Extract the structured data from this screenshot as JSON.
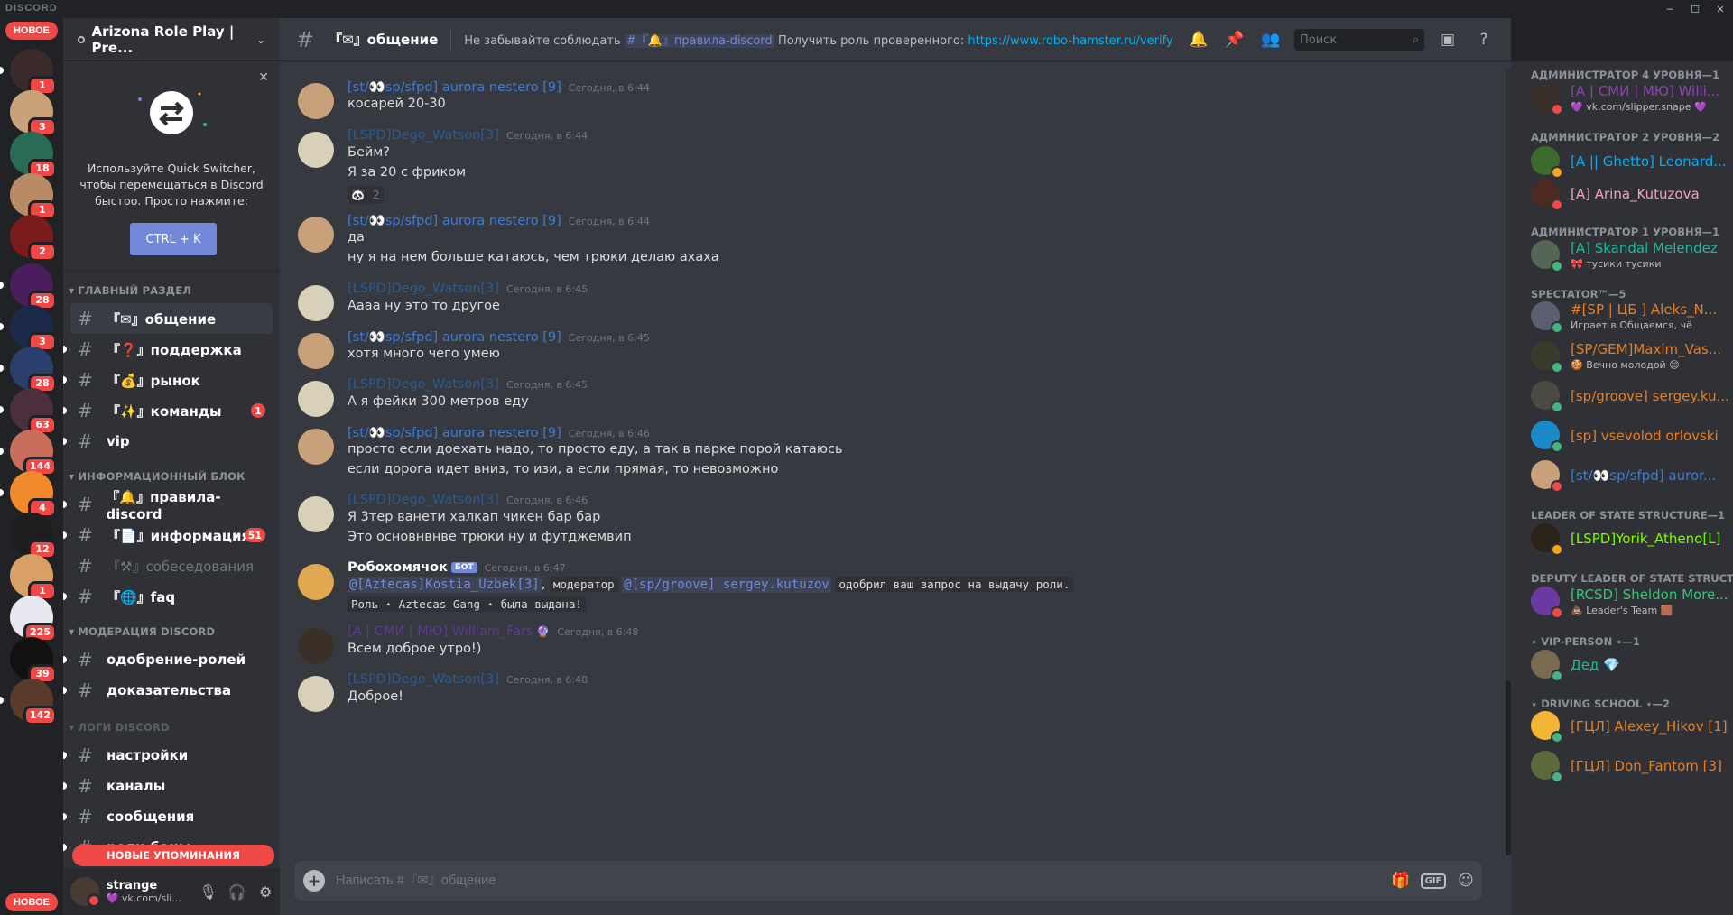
{
  "app": {
    "brand": "DISCORD",
    "new_label": "НОВОЕ"
  },
  "colors": {
    "accent": "#7289da",
    "mention_red": "#f04747",
    "online": "#43b581",
    "idle": "#faa61a",
    "dnd": "#f04747"
  },
  "servers": [
    {
      "badge": "1"
    },
    {
      "badge": "3"
    },
    {
      "badge": "18"
    },
    {
      "badge": "1"
    },
    {
      "badge": "2"
    },
    {
      "badge": "28"
    },
    {
      "badge": "3"
    },
    {
      "badge": "28"
    },
    {
      "badge": "63"
    },
    {
      "badge": "144"
    },
    {
      "badge": "4"
    },
    {
      "badge": "12"
    },
    {
      "badge": "1"
    },
    {
      "badge": "225"
    },
    {
      "badge": "39"
    },
    {
      "badge": "142"
    }
  ],
  "guild": {
    "name": "Arizona Role Play | Pre..."
  },
  "quick_switcher": {
    "text": "Используйте Quick Switcher, чтобы перемещаться в Discord быстро. Просто нажмите:",
    "button": "CTRL + K"
  },
  "categories": {
    "main": "ГЛАВНЫЙ РАЗДЕЛ",
    "info": "ИНФОРМАЦИОННЫЙ БЛОК",
    "mod": "МОДЕРАЦИЯ DISCORD",
    "logs": "ЛОГИ DISCORD"
  },
  "channels": {
    "general": "『✉』общение",
    "support": "『❓』поддержка",
    "market": "『💰』рынок",
    "commands": "『✨』команды",
    "commands_badge": "1",
    "vip": "vip",
    "rules": "『🔔』правила-discord",
    "info": "『📄』информация",
    "info_badge": "51",
    "interviews": "『⚒』собеседования",
    "faq": "『🌐』faq",
    "role_approve": "одобрение-ролей",
    "proofs": "доказательства",
    "settings": "настройки",
    "chan_logs": "каналы",
    "msg_logs": "сообщения",
    "role_bans": "роли-баны"
  },
  "new_mentions": "НОВЫЕ УПОМИНАНИЯ",
  "user": {
    "name": "strange",
    "status": "💜 vk.com/sli..."
  },
  "topbar": {
    "channel": "『✉』общение",
    "topic_before": "Не забывайте соблюдать",
    "topic_mention": "#『🔔』правила-discord",
    "topic_middle": "Получить роль проверенного:",
    "topic_link": "https://www.robo-hamster.ru/verify",
    "search_placeholder": "Поиск"
  },
  "messages": [
    {
      "author": "[st/👀sp/sfpd] aurora nestero [9]",
      "time": "Сегодня, в 6:44",
      "lines": [
        "косарей 20-30"
      ]
    },
    {
      "author": "[LSPD]Dego_Watson[3]",
      "time": "Сегодня, в 6:44",
      "lines": [
        "Бейм?",
        "Я за 20 с фриком"
      ],
      "reaction": "2"
    },
    {
      "author": "[st/👀sp/sfpd] aurora nestero [9]",
      "time": "Сегодня, в 6:44",
      "lines": [
        "да",
        "ну я на нем больше катаюсь, чем трюки делаю ахаха"
      ]
    },
    {
      "author": "[LSPD]Dego_Watson[3]",
      "time": "Сегодня, в 6:45",
      "lines": [
        "Аааа ну это то другое"
      ]
    },
    {
      "author": "[st/👀sp/sfpd] aurora nestero [9]",
      "time": "Сегодня, в 6:45",
      "lines": [
        "хотя много чего умею"
      ]
    },
    {
      "author": "[LSPD]Dego_Watson[3]",
      "time": "Сегодня, в 6:45",
      "lines": [
        "А я фейки 300 метров еду"
      ]
    },
    {
      "author": "[st/👀sp/sfpd] aurora nestero [9]",
      "time": "Сегодня, в 6:46",
      "lines": [
        "просто если доехать надо, то просто еду, а так в парке порой катаюсь",
        "если дорога идет вниз, то изи, а если прямая, то невозможно"
      ]
    },
    {
      "author": "[LSPD]Dego_Watson[3]",
      "time": "Сегодня, в 6:46",
      "lines": [
        "Я 3тер ванети халкап чикен бар бар",
        "Это основнвнве трюки ну и футджемвип"
      ]
    },
    {
      "author": "Робохомячок",
      "bot": "БОТ",
      "time": "Сегодня, в 6:47",
      "mention1": "@[Aztecas]Kostia_Uzbek[3]",
      "code1": "модератор",
      "mention2": "@[sp/groove] sergey.kutuzov",
      "code2": "одобрил ваш запрос на выдачу роли.",
      "code3": "Роль ⋆ Aztecas Gang ⋆ была выдана!"
    },
    {
      "author": "[A | СМИ | МЮ] William_Fars",
      "time": "Сегодня, в 6:48",
      "lines": [
        "Всем доброе утро!)"
      ]
    },
    {
      "author": "[LSPD]Dego_Watson[3]",
      "time": "Сегодня, в 6:48",
      "lines": [
        "Доброе!"
      ]
    }
  ],
  "composer": {
    "placeholder": "Написать #『✉』общение",
    "gif": "GIF"
  },
  "members": {
    "groups": [
      "АДМИНИСТРАТОР 4 УРОВНЯ—1",
      "АДМИНИСТРАТОР 2 УРОВНЯ—2",
      "АДМИНИСТРАТОР 1 УРОВНЯ—1",
      "SPECTATOR™—5",
      "LEADER OF STATE STRUCTURE—1",
      "DEPUTY LEADER OF STATE STRUCT...",
      "⋆ VIP-PERSON ⋆—1",
      "⋆ DRIVING SCHOOL ⋆—2"
    ],
    "list": [
      {
        "name": "[A | СМИ | МЮ] Willi...",
        "sub": "💜 vk.com/slipper.snape 💜",
        "color": "#8e44ad"
      },
      {
        "name": "[A || Ghetto] Leonard...",
        "color": "#00aff4"
      },
      {
        "name": "[A] Arina_Kutuzova",
        "color": "#f3a2b9"
      },
      {
        "name": "[A] Skandal Melendez",
        "sub": "🎀 тусики тусики",
        "color": "#1abc9c"
      },
      {
        "name": "#[SP | ЦБ ] Aleks_N...",
        "sub": "Играет в Общаемся, чё",
        "color": "#e67e22"
      },
      {
        "name": "[SP/GEM]Maxim_Vas...",
        "sub": "🍪 Вечно молодой 😊",
        "color": "#e67e22"
      },
      {
        "name": "[sp/groove] sergey.ku...",
        "color": "#e67e22"
      },
      {
        "name": "[sp] vsevolod orlovski",
        "color": "#e67e22"
      },
      {
        "name": "[st/👀sp/sfpd] auror...",
        "color": "#3d7cd6"
      },
      {
        "name": "[LSPD]Yorik_Atheno[L]",
        "color": "#7cfc00"
      },
      {
        "name": "[RCSD] Sheldon More...",
        "sub": "💩 Leader's Team 🟫",
        "color": "#2ecc71"
      },
      {
        "name": "Дед 💎",
        "color": "#1abc9c"
      },
      {
        "name": "[ГЦЛ] Alexey_Hikov [1]",
        "color": "#e67e22"
      },
      {
        "name": "[ГЦЛ] Don_Fantom [3]",
        "color": "#e67e22"
      }
    ]
  }
}
